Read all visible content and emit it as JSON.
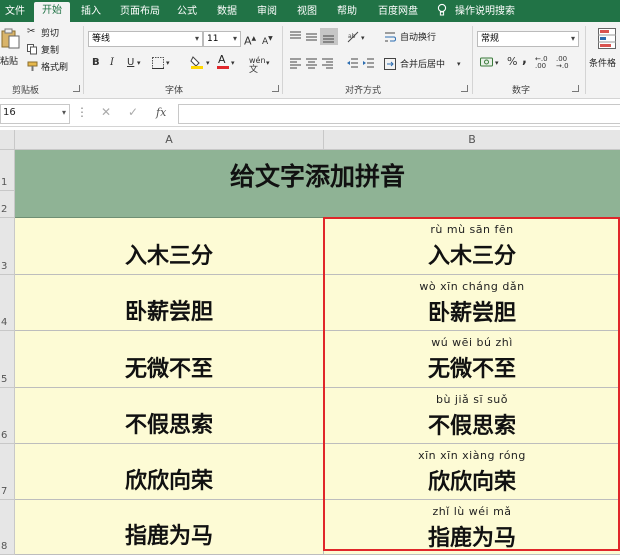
{
  "tabs": [
    "文件",
    "开始",
    "插入",
    "页面布局",
    "公式",
    "数据",
    "审阅",
    "视图",
    "帮助",
    "百度网盘",
    "操作说明搜索"
  ],
  "ribbon": {
    "paste": "粘贴",
    "cut": "剪切",
    "copy": "复制",
    "format_painter": "格式刷",
    "clipboard_label": "剪贴板",
    "font_name": "等线",
    "font_size": "11",
    "font_label": "字体",
    "wrap_text": "自动换行",
    "merge_center": "合并后居中",
    "alignment_label": "对齐方式",
    "number_format": "常规",
    "number_label": "数字",
    "conditional": "条件格"
  },
  "formula_bar": {
    "name_box": "16",
    "fx": "fx"
  },
  "columns": [
    "A",
    "B"
  ],
  "title": "给文字添加拼音",
  "rows": [
    {
      "num": "3",
      "word": "入木三分",
      "pinyin": "rù mù sān fēn"
    },
    {
      "num": "4",
      "word": "卧薪尝胆",
      "pinyin": "wò xīn cháng dǎn"
    },
    {
      "num": "5",
      "word": "无微不至",
      "pinyin": "wú wēi bú zhì"
    },
    {
      "num": "6",
      "word": "不假思索",
      "pinyin": "bù jiǎ sī suǒ"
    },
    {
      "num": "7",
      "word": "欣欣向荣",
      "pinyin": "xīn xīn xiàng róng"
    },
    {
      "num": "8",
      "word": "指鹿为马",
      "pinyin": "zhǐ lù wéi mǎ"
    }
  ],
  "row_labels": [
    "1",
    "2"
  ],
  "colors": {
    "excel_green": "#217346",
    "title_fill": "#8fb395",
    "cell_fill": "#fdfbd5",
    "selection": "#e0262a"
  }
}
